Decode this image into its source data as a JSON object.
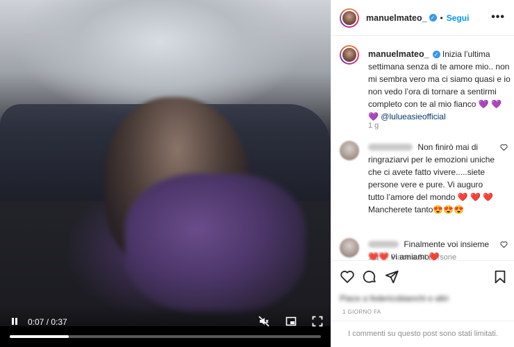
{
  "video": {
    "time": "0:07 / 0:37",
    "progress": 0.19
  },
  "header": {
    "username": "manuelmateo_",
    "separator": "•",
    "follow_label": "Segui",
    "more_icon": "more-horizontal-icon"
  },
  "caption": {
    "username": "manuelmateo_",
    "text": "Inizia l’ultima settimana senza di te amore mio.. non mi sembra vero ma ci siamo quasi e io non vedo l’ora di tornare a sentirmi completo con te al mio fianco",
    "hearts": "💜 💜 💜",
    "mention": "@lulueasieofficial",
    "age": "1 g"
  },
  "comments": [
    {
      "text": "Non finirò mai di ringraziarvi per le emozioni uniche che ci avete fatto vivere.....siete persone vere e pure. Vi auguro tutto l’amore del mondo",
      "hearts": "❤️ ❤️ ❤️",
      "tail": "Mancherete tanto",
      "emojis": "😍😍😍",
      "age": "1 g",
      "likes": "Piace a 84 persone"
    },
    {
      "text": "Finalmente voi insieme",
      "prefix_emojis": "❤️❤️",
      "tail": "vi amiamo",
      "tail_emoji": "❤️",
      "age": "1 g",
      "likes": ""
    }
  ],
  "liked_by": "Piace a federicobianchi e altri",
  "date": "1 GIORNO FA",
  "comments_limited": "I commenti su questo post sono stati limitati.",
  "colors": {
    "follow": "#0095f6",
    "verified": "#3897f0",
    "mention": "#00376b",
    "muted": "#8e8e8e"
  }
}
